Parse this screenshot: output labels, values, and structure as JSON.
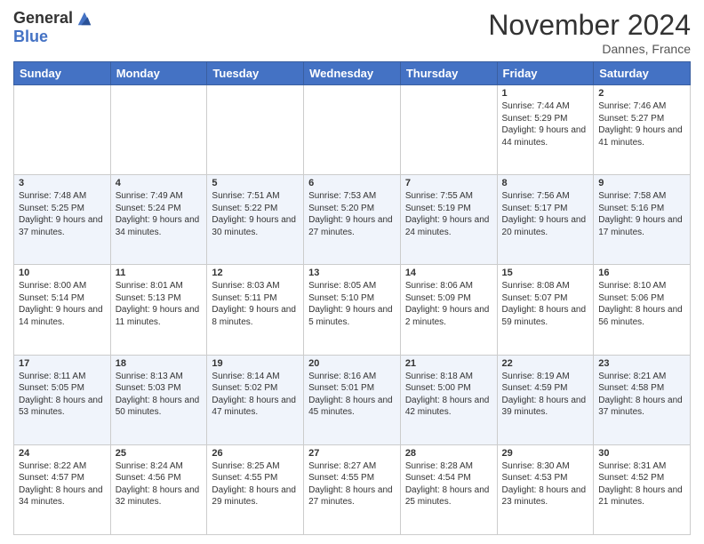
{
  "logo": {
    "general": "General",
    "blue": "Blue"
  },
  "title": "November 2024",
  "location": "Dannes, France",
  "days_of_week": [
    "Sunday",
    "Monday",
    "Tuesday",
    "Wednesday",
    "Thursday",
    "Friday",
    "Saturday"
  ],
  "weeks": [
    [
      {
        "day": "",
        "info": ""
      },
      {
        "day": "",
        "info": ""
      },
      {
        "day": "",
        "info": ""
      },
      {
        "day": "",
        "info": ""
      },
      {
        "day": "",
        "info": ""
      },
      {
        "day": "1",
        "info": "Sunrise: 7:44 AM\nSunset: 5:29 PM\nDaylight: 9 hours and 44 minutes."
      },
      {
        "day": "2",
        "info": "Sunrise: 7:46 AM\nSunset: 5:27 PM\nDaylight: 9 hours and 41 minutes."
      }
    ],
    [
      {
        "day": "3",
        "info": "Sunrise: 7:48 AM\nSunset: 5:25 PM\nDaylight: 9 hours and 37 minutes."
      },
      {
        "day": "4",
        "info": "Sunrise: 7:49 AM\nSunset: 5:24 PM\nDaylight: 9 hours and 34 minutes."
      },
      {
        "day": "5",
        "info": "Sunrise: 7:51 AM\nSunset: 5:22 PM\nDaylight: 9 hours and 30 minutes."
      },
      {
        "day": "6",
        "info": "Sunrise: 7:53 AM\nSunset: 5:20 PM\nDaylight: 9 hours and 27 minutes."
      },
      {
        "day": "7",
        "info": "Sunrise: 7:55 AM\nSunset: 5:19 PM\nDaylight: 9 hours and 24 minutes."
      },
      {
        "day": "8",
        "info": "Sunrise: 7:56 AM\nSunset: 5:17 PM\nDaylight: 9 hours and 20 minutes."
      },
      {
        "day": "9",
        "info": "Sunrise: 7:58 AM\nSunset: 5:16 PM\nDaylight: 9 hours and 17 minutes."
      }
    ],
    [
      {
        "day": "10",
        "info": "Sunrise: 8:00 AM\nSunset: 5:14 PM\nDaylight: 9 hours and 14 minutes."
      },
      {
        "day": "11",
        "info": "Sunrise: 8:01 AM\nSunset: 5:13 PM\nDaylight: 9 hours and 11 minutes."
      },
      {
        "day": "12",
        "info": "Sunrise: 8:03 AM\nSunset: 5:11 PM\nDaylight: 9 hours and 8 minutes."
      },
      {
        "day": "13",
        "info": "Sunrise: 8:05 AM\nSunset: 5:10 PM\nDaylight: 9 hours and 5 minutes."
      },
      {
        "day": "14",
        "info": "Sunrise: 8:06 AM\nSunset: 5:09 PM\nDaylight: 9 hours and 2 minutes."
      },
      {
        "day": "15",
        "info": "Sunrise: 8:08 AM\nSunset: 5:07 PM\nDaylight: 8 hours and 59 minutes."
      },
      {
        "day": "16",
        "info": "Sunrise: 8:10 AM\nSunset: 5:06 PM\nDaylight: 8 hours and 56 minutes."
      }
    ],
    [
      {
        "day": "17",
        "info": "Sunrise: 8:11 AM\nSunset: 5:05 PM\nDaylight: 8 hours and 53 minutes."
      },
      {
        "day": "18",
        "info": "Sunrise: 8:13 AM\nSunset: 5:03 PM\nDaylight: 8 hours and 50 minutes."
      },
      {
        "day": "19",
        "info": "Sunrise: 8:14 AM\nSunset: 5:02 PM\nDaylight: 8 hours and 47 minutes."
      },
      {
        "day": "20",
        "info": "Sunrise: 8:16 AM\nSunset: 5:01 PM\nDaylight: 8 hours and 45 minutes."
      },
      {
        "day": "21",
        "info": "Sunrise: 8:18 AM\nSunset: 5:00 PM\nDaylight: 8 hours and 42 minutes."
      },
      {
        "day": "22",
        "info": "Sunrise: 8:19 AM\nSunset: 4:59 PM\nDaylight: 8 hours and 39 minutes."
      },
      {
        "day": "23",
        "info": "Sunrise: 8:21 AM\nSunset: 4:58 PM\nDaylight: 8 hours and 37 minutes."
      }
    ],
    [
      {
        "day": "24",
        "info": "Sunrise: 8:22 AM\nSunset: 4:57 PM\nDaylight: 8 hours and 34 minutes."
      },
      {
        "day": "25",
        "info": "Sunrise: 8:24 AM\nSunset: 4:56 PM\nDaylight: 8 hours and 32 minutes."
      },
      {
        "day": "26",
        "info": "Sunrise: 8:25 AM\nSunset: 4:55 PM\nDaylight: 8 hours and 29 minutes."
      },
      {
        "day": "27",
        "info": "Sunrise: 8:27 AM\nSunset: 4:55 PM\nDaylight: 8 hours and 27 minutes."
      },
      {
        "day": "28",
        "info": "Sunrise: 8:28 AM\nSunset: 4:54 PM\nDaylight: 8 hours and 25 minutes."
      },
      {
        "day": "29",
        "info": "Sunrise: 8:30 AM\nSunset: 4:53 PM\nDaylight: 8 hours and 23 minutes."
      },
      {
        "day": "30",
        "info": "Sunrise: 8:31 AM\nSunset: 4:52 PM\nDaylight: 8 hours and 21 minutes."
      }
    ]
  ]
}
